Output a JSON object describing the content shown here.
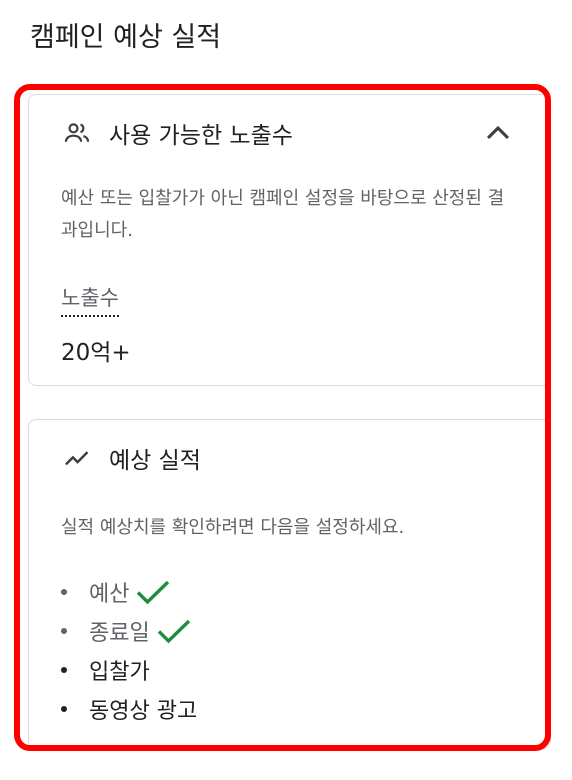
{
  "page": {
    "title": "캠페인 예상 실적"
  },
  "reach_card": {
    "icon": "people-icon",
    "title": "사용 가능한 노출수",
    "collapse_icon": "chevron-up-icon",
    "description": "예산 또는 입찰가가 아닌 캠페인 설정을 바탕으로 산정된 결과입니다.",
    "metric_label": "노출수",
    "metric_value": "20억+"
  },
  "performance_card": {
    "icon": "trending-icon",
    "title": "예상 실적",
    "description": "실적 예상치를 확인하려면 다음을 설정하세요.",
    "items": [
      {
        "label": "예산",
        "done": true
      },
      {
        "label": "종료일",
        "done": true
      },
      {
        "label": "입찰가",
        "done": false
      },
      {
        "label": "동영상 광고",
        "done": false
      }
    ]
  },
  "colors": {
    "highlight": "#ff0000",
    "check": "#1e8e3e",
    "done_text": "#5f6368",
    "pending_text": "#202124",
    "border": "#dadce0"
  }
}
